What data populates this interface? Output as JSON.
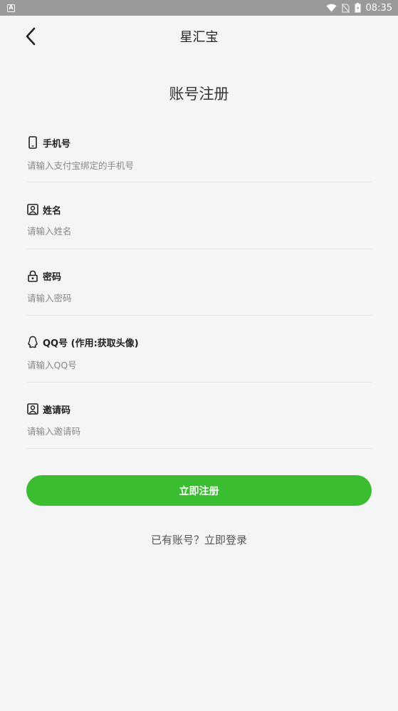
{
  "status_bar": {
    "time": "08:35"
  },
  "nav": {
    "title": "星汇宝"
  },
  "page_title": "账号注册",
  "fields": [
    {
      "label": "手机号",
      "placeholder": "请输入支付宝绑定的手机号",
      "icon": "phone-icon"
    },
    {
      "label": "姓名",
      "placeholder": "请输入姓名",
      "icon": "user-card-icon"
    },
    {
      "label": "密码",
      "placeholder": "请输入密码",
      "icon": "lock-icon"
    },
    {
      "label": "QQ号 (作用:获取头像)",
      "placeholder": "请输入QQ号",
      "icon": "qq-icon"
    },
    {
      "label": "邀请码",
      "placeholder": "请输入邀请码",
      "icon": "user-card-icon"
    }
  ],
  "register_button": "立即注册",
  "login_link": "已有账号？立即登录",
  "colors": {
    "accent": "#3bbd31",
    "background": "#f5f5f5",
    "status_bar": "#9a9a9a"
  }
}
